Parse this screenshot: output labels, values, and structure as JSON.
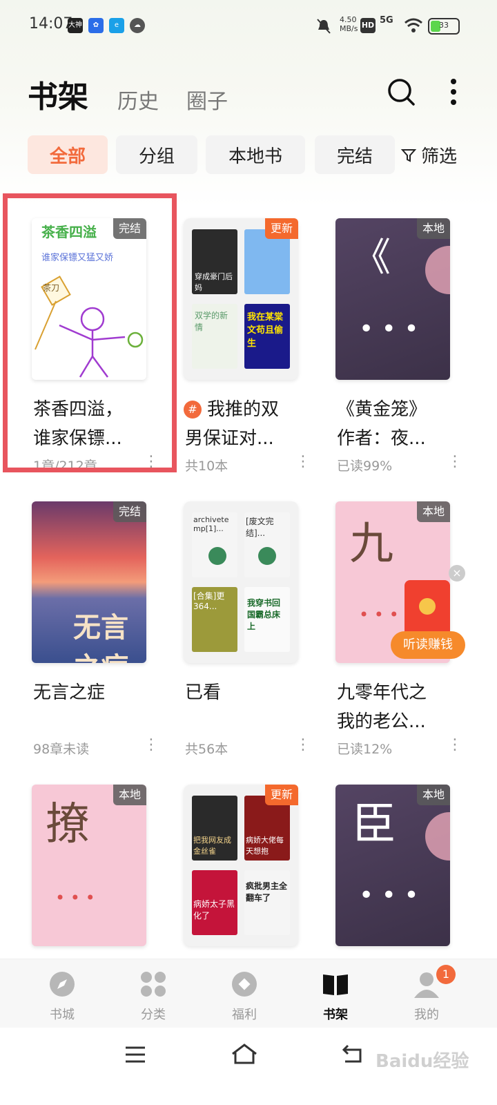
{
  "status_bar": {
    "time": "14:07",
    "speed": "4.50",
    "speed_unit": "MB/s",
    "network": "5G",
    "battery": "33",
    "app_icon_1": "大神"
  },
  "header": {
    "title": "书架",
    "tabs": [
      "历史",
      "圈子"
    ]
  },
  "filters": {
    "chips": [
      "全部",
      "分组",
      "本地书",
      "完结"
    ],
    "filter_label": "筛选"
  },
  "books": [
    {
      "title": "茶香四溢，\n谁家保镖...",
      "meta": "1章/212章",
      "badge": "完结",
      "cover_title": "茶香四溢",
      "cover_subtitle": "谁家保镖又猛又娇",
      "cover_flag": "茶刀"
    },
    {
      "title": "我推的双\n男保证对...",
      "meta": "共10本",
      "badge": "更新",
      "group_tag": "#"
    },
    {
      "title": "《黄金笼》\n作者：夜...",
      "meta": "已读99%",
      "badge": "本地",
      "cover_char": "《"
    },
    {
      "title": "无言之症",
      "meta": "98章未读",
      "badge": "完结",
      "cover_title": "无言之症"
    },
    {
      "title": "已看",
      "meta": "共56本",
      "badge": ""
    },
    {
      "title": "九零年代之\n我的老公...",
      "meta": "已读12%",
      "badge": "本地",
      "cover_char": "九"
    },
    {
      "title": "",
      "meta": "",
      "badge": "本地",
      "cover_char": "撩"
    },
    {
      "title": "",
      "meta": "",
      "badge": "更新"
    },
    {
      "title": "",
      "meta": "",
      "badge": "本地",
      "cover_char": "臣"
    }
  ],
  "group_minis": {
    "g1": [
      "穿成豪门后妈",
      "",
      "双学的新情",
      "我在某棠文苟且偷生"
    ],
    "g2": [
      "archivetemp[1]...",
      "[废文完结]...",
      "[合集]更364...",
      "我穿书回国霸总床上"
    ],
    "g3": [
      "把我网友成金丝雀",
      "病娇大佬每天想抱",
      "病娇太子黑化了",
      "疯批男主全翻车了"
    ]
  },
  "float_ad": {
    "label": "听读赚钱",
    "close": "×"
  },
  "bottom_nav": [
    {
      "label": "书城"
    },
    {
      "label": "分类"
    },
    {
      "label": "福利"
    },
    {
      "label": "书架"
    },
    {
      "label": "我的",
      "badge": "1"
    }
  ],
  "watermark": "Baidu经验"
}
